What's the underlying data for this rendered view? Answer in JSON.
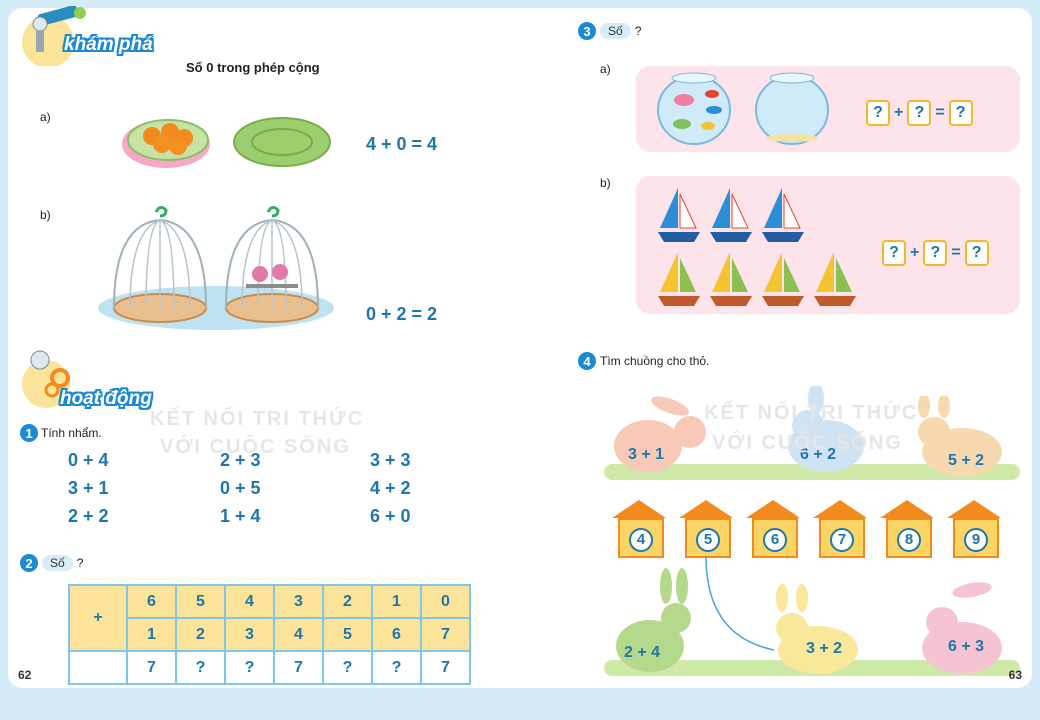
{
  "left_page": {
    "page_number": "62",
    "kham_pha_label": "khám phá",
    "title": "Số 0 trong phép cộng",
    "part_a_label": "a)",
    "part_a_equation": "4 + 0 = 4",
    "part_b_label": "b)",
    "part_b_equation": "0 + 2 = 2",
    "hoat_dong_label": "hoạt động",
    "ex1": {
      "number": "1",
      "instruction": "Tính nhẩm.",
      "columns": [
        [
          "0 + 4",
          "3 + 1",
          "2 + 2"
        ],
        [
          "2 + 3",
          "0 + 5",
          "1 + 4"
        ],
        [
          "3 + 3",
          "4 + 2",
          "6 + 0"
        ]
      ]
    },
    "ex2": {
      "number": "2",
      "so_label": "Số",
      "question_mark": "?",
      "plus_sign": "+",
      "row1": [
        "6",
        "5",
        "4",
        "3",
        "2",
        "1",
        "0"
      ],
      "row2": [
        "1",
        "2",
        "3",
        "4",
        "5",
        "6",
        "7"
      ],
      "row3": [
        "7",
        "?",
        "?",
        "7",
        "?",
        "?",
        "7"
      ]
    }
  },
  "right_page": {
    "page_number": "63",
    "ex3": {
      "number": "3",
      "so_label": "Số",
      "question_mark": "?",
      "part_a_label": "a)",
      "part_b_label": "b)",
      "box_q": "?",
      "plus": "+",
      "equals": "="
    },
    "ex4": {
      "number": "4",
      "instruction": "Tìm chuồng cho thỏ.",
      "top_rabbits": [
        "3 + 1",
        "6 + 2",
        "5 + 2"
      ],
      "houses": [
        "4",
        "5",
        "6",
        "7",
        "8",
        "9"
      ],
      "bottom_rabbits": [
        "2 + 4",
        "3 + 2",
        "6 + 3"
      ]
    },
    "watermark_line1": "KẾT NỐI TRI THỨC",
    "watermark_line2": "VỚI CUỘC SỐNG"
  },
  "colors": {
    "accent_blue": "#1f76a8",
    "table_yellow": "#fbe39a",
    "badge_blue": "#1b8ad0",
    "page_bg": "#d4ecf8"
  }
}
